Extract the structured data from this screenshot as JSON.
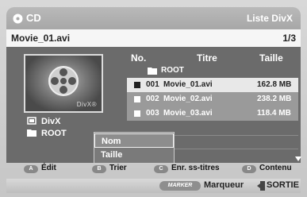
{
  "header": {
    "title": "CD",
    "mode": "Liste DivX"
  },
  "file": {
    "name": "Movie_01.avi",
    "page": "1/3"
  },
  "thumbnail": {
    "brand": "DivX®"
  },
  "meta": {
    "format": "DivX",
    "folder": "ROOT"
  },
  "table": {
    "columns": [
      "No.",
      "Titre",
      "Taille"
    ],
    "root_label": "ROOT",
    "rows": [
      {
        "no": "001",
        "title": "Movie_01.avi",
        "size": "162.8 MB"
      },
      {
        "no": "002",
        "title": "Movie_02.avi",
        "size": "238.2 MB"
      },
      {
        "no": "003",
        "title": "Movie_03.avi",
        "size": "118.4 MB"
      }
    ]
  },
  "context_menu": {
    "items": [
      "Nom",
      "Taille"
    ]
  },
  "keys": [
    {
      "btn": "A",
      "label": "Édit"
    },
    {
      "btn": "B",
      "label": "Trier"
    },
    {
      "btn": "C",
      "label": "Enr. ss-titres"
    },
    {
      "btn": "D",
      "label": "Contenu"
    }
  ],
  "footer": {
    "marker_btn": "MARKER",
    "marker_label": "Marqueur",
    "exit_label": "SORTIE"
  }
}
